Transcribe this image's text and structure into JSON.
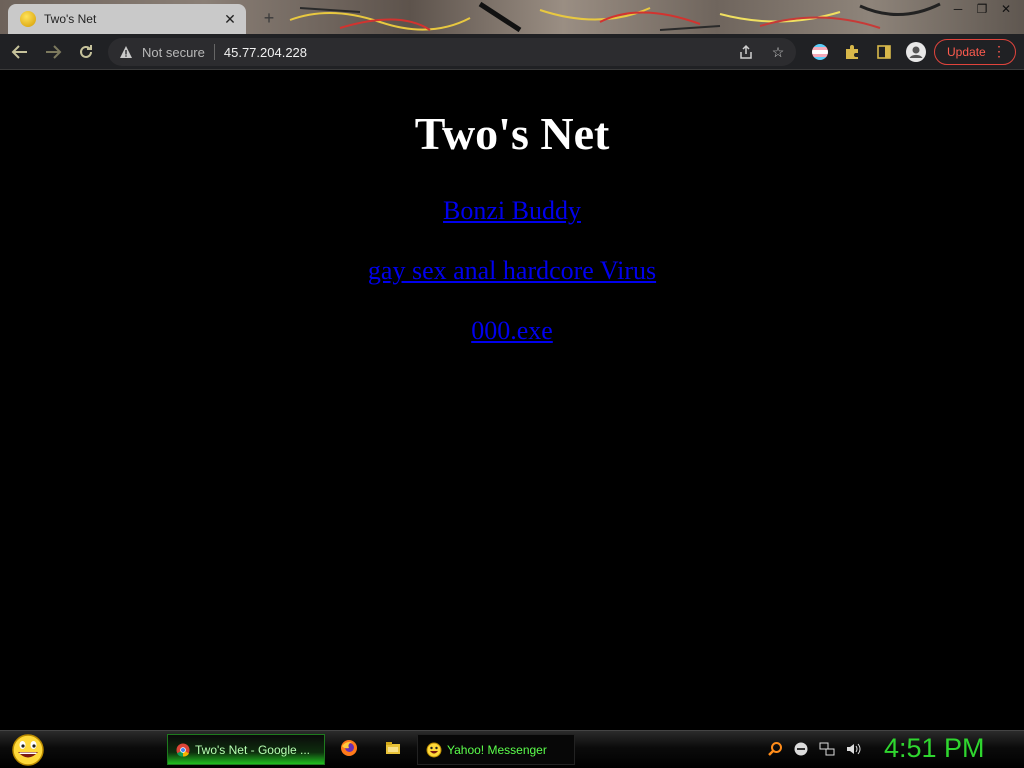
{
  "browser": {
    "tab_title": "Two's Net",
    "tab_close": "✕",
    "new_tab": "+",
    "security_label": "Not secure",
    "url": "45.77.204.228",
    "update_label": "Update"
  },
  "page": {
    "heading": "Two's Net",
    "links": [
      {
        "text": "Bonzi Buddy"
      },
      {
        "text": "gay sex anal hardcore Virus"
      },
      {
        "text": "000.exe"
      }
    ],
    "link_color": "#0000ee"
  },
  "taskbar": {
    "items": [
      {
        "label": "Two's Net - Google ..."
      },
      {
        "label": "Yahoo! Messenger"
      }
    ],
    "clock": "4:51 PM",
    "accent": "#2fd62f"
  }
}
